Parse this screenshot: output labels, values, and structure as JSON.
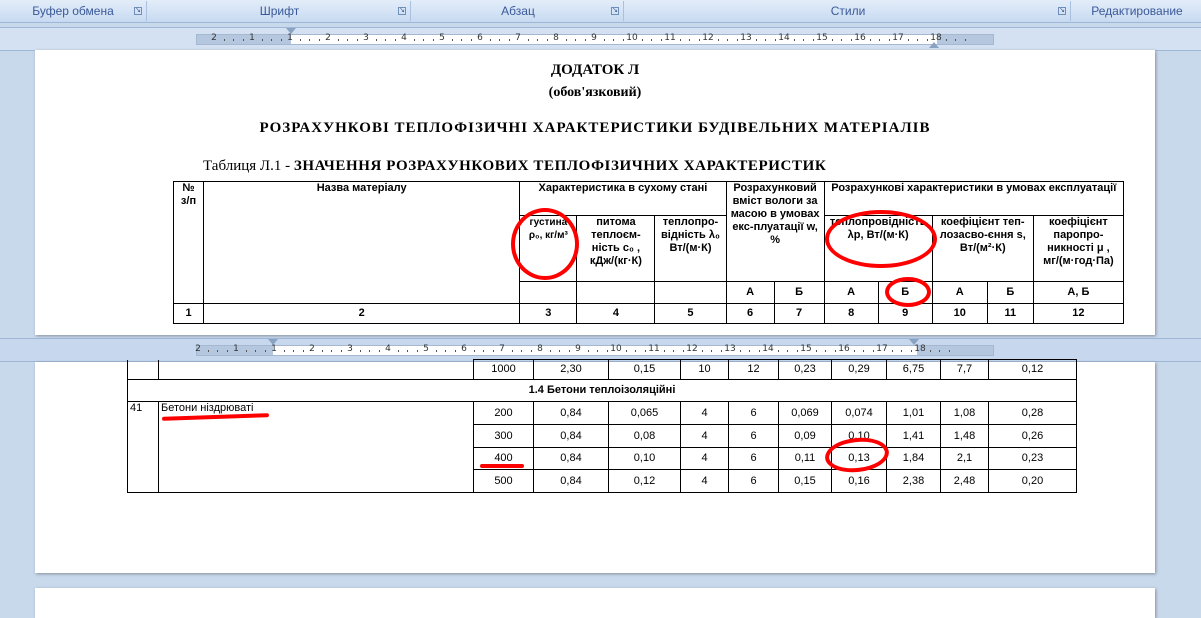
{
  "ribbon": {
    "groups": [
      "Буфер обмена",
      "Шрифт",
      "Абзац",
      "Стили",
      "Редактирование"
    ]
  },
  "ruler_top": {
    "numbers": [
      "2",
      "1",
      "1",
      "2",
      "3",
      "4",
      "5",
      "6",
      "7",
      "8",
      "9",
      "10",
      "11",
      "12",
      "13",
      "14",
      "15",
      "16",
      "17",
      "18"
    ]
  },
  "ruler_mid": {
    "numbers": [
      "2",
      "1",
      "1",
      "2",
      "3",
      "4",
      "5",
      "6",
      "7",
      "8",
      "9",
      "10",
      "11",
      "12",
      "13",
      "14",
      "15",
      "16",
      "17",
      "18"
    ]
  },
  "doc": {
    "appendix_title": "ДОДАТОК Л",
    "appendix_sub": "(обов'язковий)",
    "heading": "РОЗРАХУНКОВІ ТЕПЛОФІЗИЧНІ ХАРАКТЕРИСТИКИ БУДІВЕЛЬНИХ МАТЕРІАЛІВ",
    "table_caption_prefix": "Таблиця Л.1 - ",
    "table_caption_bold": "ЗНАЧЕННЯ РОЗРАХУНКОВИХ ТЕПЛОФІЗИЧНИХ ХАРАКТЕРИСТИК"
  },
  "header": {
    "no": "№\nз/п",
    "name": "Назва матеріалу",
    "dry": "Характеристика в сухому стані",
    "moisture": "Розрахунковий вміст вологи за масою в умовах екс-плуатації w, %",
    "oper": "Розрахункові характеристики в умовах експлуатації",
    "density": "густина ρ₀, кг/м³",
    "spec_heat": "питома теплоєм-ність c₀ , кДж/(кг·К)",
    "dry_cond": "теплопро-відність λ₀ Вт/(м·К)",
    "cond": "теплопровідність λр, Вт/(м·К)",
    "absorb": "коефіцієнт теп-лозасво-єння s, Вт/(м²·К)",
    "vapor": "коефіцієнт паропро-никності μ , мг/(м·год·Па)",
    "A": "А",
    "B": "Б",
    "AB": "А, Б",
    "nums": [
      "1",
      "2",
      "3",
      "4",
      "5",
      "6",
      "7",
      "8",
      "9",
      "10",
      "11",
      "12"
    ]
  },
  "lower": {
    "prev_row": [
      "1000",
      "2,30",
      "0,15",
      "10",
      "12",
      "0,23",
      "0,29",
      "6,75",
      "7,7",
      "0,12"
    ],
    "section": "1.4 Бетони теплоізоляційні",
    "item_no": "41",
    "item_name": "Бетони ніздрюваті",
    "rows": [
      [
        "200",
        "0,84",
        "0,065",
        "4",
        "6",
        "0,069",
        "0,074",
        "1,01",
        "1,08",
        "0,28"
      ],
      [
        "300",
        "0,84",
        "0,08",
        "4",
        "6",
        "0,09",
        "0,10",
        "1,41",
        "1,48",
        "0,26"
      ],
      [
        "400",
        "0,84",
        "0,10",
        "4",
        "6",
        "0,11",
        "0,13",
        "1,84",
        "2,1",
        "0,23"
      ],
      [
        "500",
        "0,84",
        "0,12",
        "4",
        "6",
        "0,15",
        "0,16",
        "2,38",
        "2,48",
        "0,20"
      ]
    ]
  },
  "colors": {
    "annotation": "#ff0000",
    "ribbon_text": "#3b5998"
  }
}
